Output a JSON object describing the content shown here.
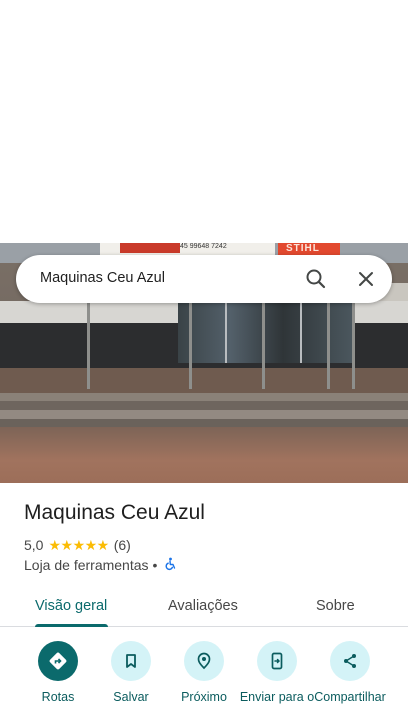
{
  "search": {
    "query": "Maquinas Ceu Azul"
  },
  "photo": {
    "sign_text": "45 99648 7242",
    "sign_brand": "STIHL"
  },
  "place": {
    "name": "Maquinas Ceu Azul",
    "rating": "5,0",
    "stars": "★★★★★",
    "review_count": "(6)",
    "category": "Loja de ferramentas",
    "separator": "•"
  },
  "tabs": [
    {
      "label": "Visão geral",
      "active": true
    },
    {
      "label": "Avaliações",
      "active": false
    },
    {
      "label": "Sobre",
      "active": false
    }
  ],
  "actions": [
    {
      "label": "Rotas",
      "icon": "directions-icon"
    },
    {
      "label": "Salvar",
      "icon": "bookmark-icon"
    },
    {
      "label": "Próximo",
      "icon": "nearby-icon"
    },
    {
      "label": "Enviar para o",
      "icon": "send-to-phone-icon"
    },
    {
      "label": "Compartilhar",
      "icon": "share-icon"
    }
  ],
  "colors": {
    "accent": "#0b6a6c",
    "action_bg": "#d4f3f7",
    "star": "#fbbc04",
    "accessibility": "#1a73e8"
  }
}
